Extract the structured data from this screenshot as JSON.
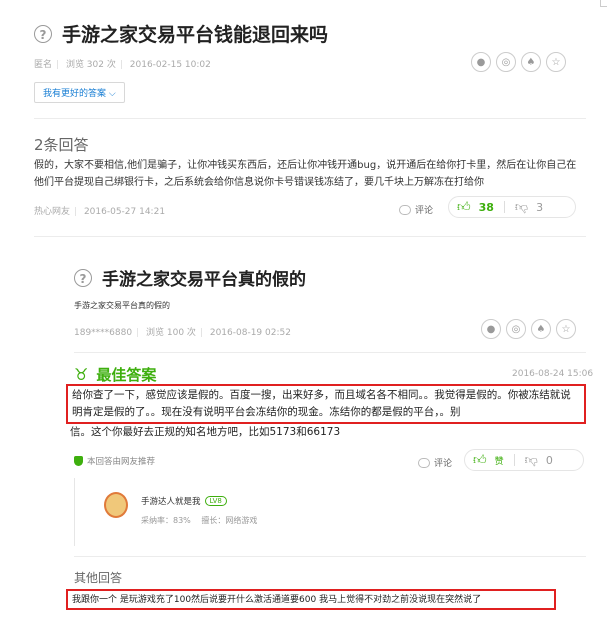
{
  "question": {
    "title": "手游之家交易平台钱能退回来吗",
    "user": "匿名",
    "views": "浏览 302 次",
    "date": "2016-02-15 10:02",
    "better_answer_btn": "我有更好的答案"
  },
  "answers_count": "2条回答",
  "answer1": {
    "text": "假的，大家不要相信,他们是骗子，让你冲钱买东西后，还后让你冲钱开通bug，说开通后在给你打卡里，然后在让你自己在他们平台提现自己绑银行卡，之后系统会给你信息说你卡号错误钱冻结了，要几千块上万解冻在打给你",
    "user": "热心网友",
    "date": "2016-05-27 14:21",
    "comment_label": "评论",
    "up_count": "38",
    "down_count": "3"
  },
  "question2": {
    "title": "手游之家交易平台真的假的",
    "subtitle": "手游之家交易平台真的假的",
    "user": "189****6880",
    "views": "浏览 100 次",
    "date": "2016-08-19 02:52"
  },
  "best_answer": {
    "heading": "最佳答案",
    "date": "2016-08-24 15:06",
    "text": "给你查了一下，感觉应该是假的。百度一搜，出来好多，而且域名各不相同。。我觉得是假的。你被冻结就说明肯定是假的了。。现在没有说明平台会冻结你的现金。冻结你的都是假的平台，。别",
    "text_tail": "信。这个你最好去正规的知名地方吧，比如5173和66173",
    "recommend": "本回答由网友推荐",
    "comment_label": "评论",
    "up_label": "赞",
    "down_count": "0"
  },
  "answerer": {
    "name": "手游达人就是我",
    "level": "LV8",
    "rate": "采纳率：83%",
    "field": "擅长：网络游戏"
  },
  "other": {
    "heading": "其他回答",
    "text": "我跟你一个 是玩游戏充了100然后说要开什么激活通道要600 我马上觉得不对劲之前没说现在突然说了"
  },
  "colors": {
    "accent_green": "#3eaf0e",
    "link_blue": "#1a7fd4",
    "highlight_red": "#e02020"
  }
}
